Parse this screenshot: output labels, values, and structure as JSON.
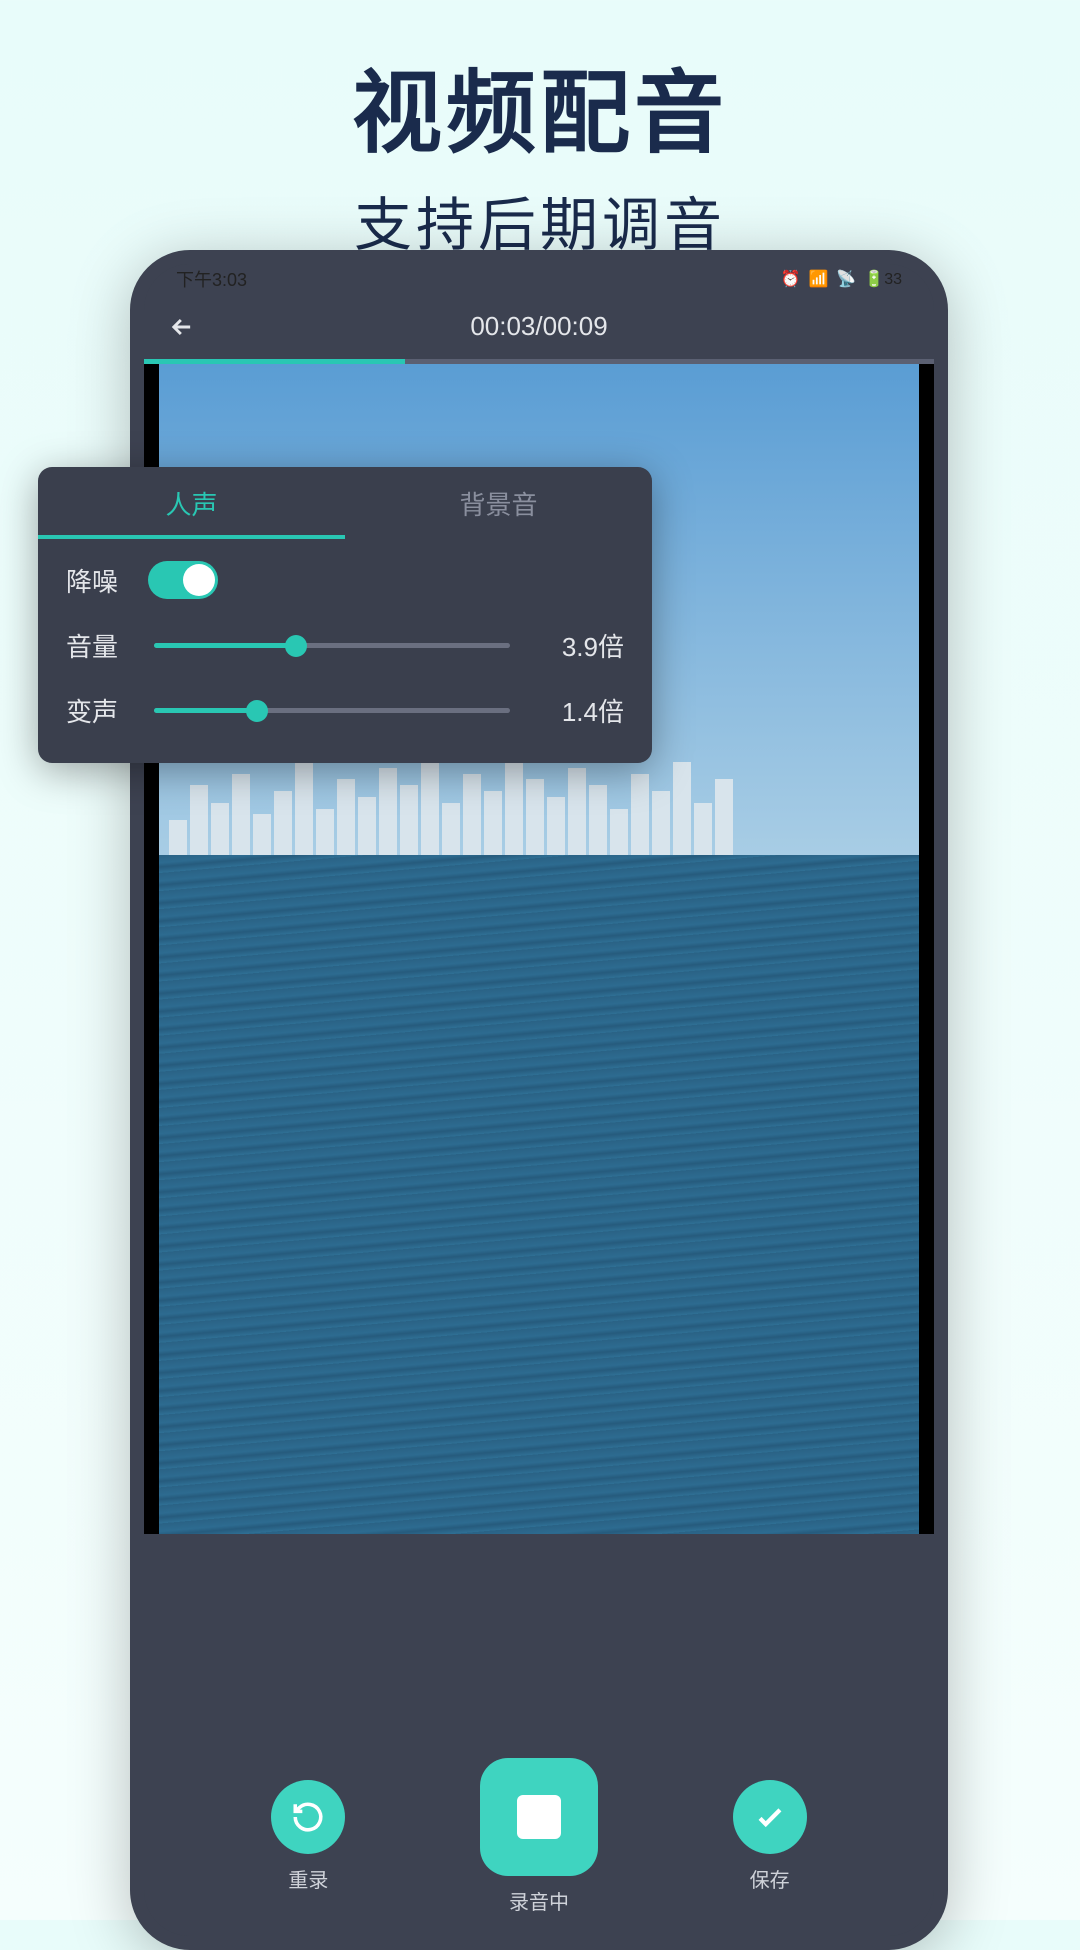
{
  "promo": {
    "title": "视频配音",
    "subtitle": "支持后期调音"
  },
  "status": {
    "time": "下午3:03",
    "battery": "33"
  },
  "header": {
    "timecode": "00:03/00:09"
  },
  "progress_pct": 33,
  "panel": {
    "tabs": [
      {
        "label": "人声",
        "active": true
      },
      {
        "label": "背景音",
        "active": false
      }
    ],
    "noise": {
      "label": "降噪",
      "on": true
    },
    "volume": {
      "label": "音量",
      "value_text": "3.9倍",
      "pct": 40
    },
    "pitch": {
      "label": "变声",
      "value_text": "1.4倍",
      "pct": 29
    }
  },
  "bottom": {
    "rerecord": "重录",
    "recording": "录音中",
    "save": "保存"
  }
}
